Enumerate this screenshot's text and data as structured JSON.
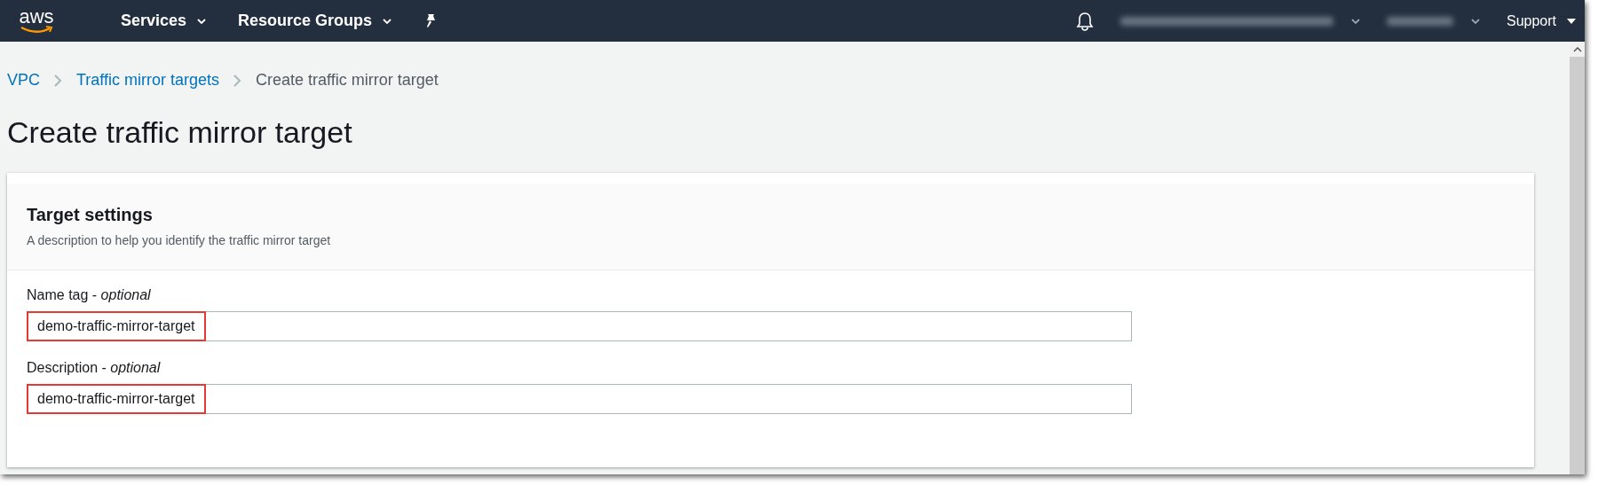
{
  "header": {
    "logo": "aws",
    "menus": [
      {
        "label": "Services"
      },
      {
        "label": "Resource Groups"
      }
    ],
    "support": "Support"
  },
  "breadcrumb": [
    {
      "label": "VPC",
      "link": true
    },
    {
      "label": "Traffic mirror targets",
      "link": true
    },
    {
      "label": "Create traffic mirror target",
      "link": false
    }
  ],
  "page_title": "Create traffic mirror target",
  "card": {
    "title": "Target settings",
    "description": "A description to help you identify the traffic mirror target",
    "fields": [
      {
        "label": "Name tag - *optional*",
        "value": "demo-traffic-mirror-target",
        "highlighted": true
      },
      {
        "label": "Description - *optional*",
        "value": "demo-traffic-mirror-target",
        "highlighted": true
      }
    ]
  }
}
